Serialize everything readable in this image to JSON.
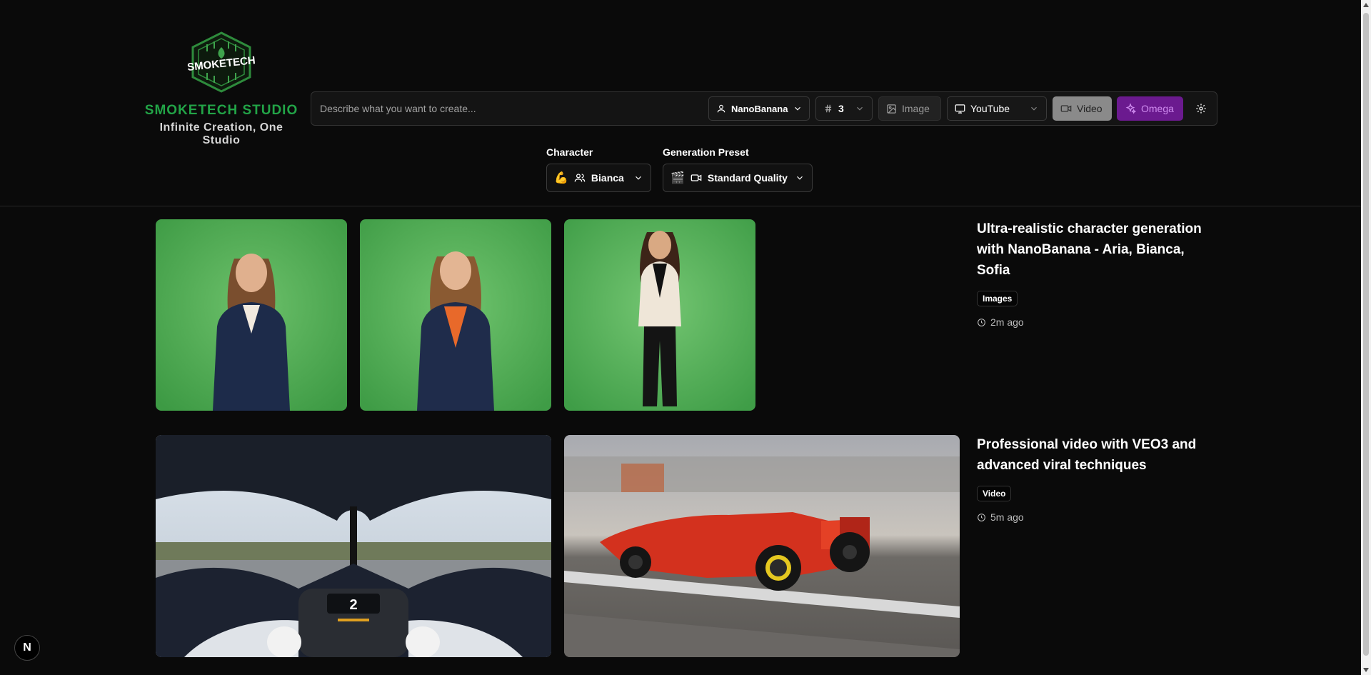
{
  "brand": {
    "logo_text": "SMOKETECH",
    "name": "SMOKETECH STUDIO",
    "tagline": "Infinite Creation, One Studio"
  },
  "prompt": {
    "placeholder": "Describe what you want to create...",
    "value": ""
  },
  "toolbar": {
    "model_icon": "user-icon",
    "model_label": "NanoBanana",
    "count_icon": "hash-icon",
    "count_value": "3",
    "image_icon": "image-icon",
    "image_label": "Image",
    "platform_icon": "monitor-icon",
    "platform_label": "YouTube",
    "video_icon": "video-camera-icon",
    "video_label": "Video",
    "omega_icon": "sparkles-icon",
    "omega_label": "Omega",
    "settings_icon": "gear-icon"
  },
  "selectors": {
    "character": {
      "label": "Character",
      "emoji": "💪",
      "icon": "users-icon",
      "value": "Bianca"
    },
    "preset": {
      "label": "Generation Preset",
      "emoji": "🎬",
      "icon": "video-camera-icon",
      "value": "Standard Quality"
    }
  },
  "feed": [
    {
      "title": "Ultra-realistic character generation with NanoBanana - Aria, Bianca, Sofia",
      "badge": "Images",
      "time": "2m ago"
    },
    {
      "title": "Professional video with VEO3 and advanced viral techniques",
      "badge": "Video",
      "time": "5m ago"
    }
  ],
  "dev_badge": "N",
  "colors": {
    "background": "#0a0a0a",
    "brand_green": "#22a447",
    "omega_purple": "#6b1a8f",
    "video_gray": "#8a8a8a"
  }
}
